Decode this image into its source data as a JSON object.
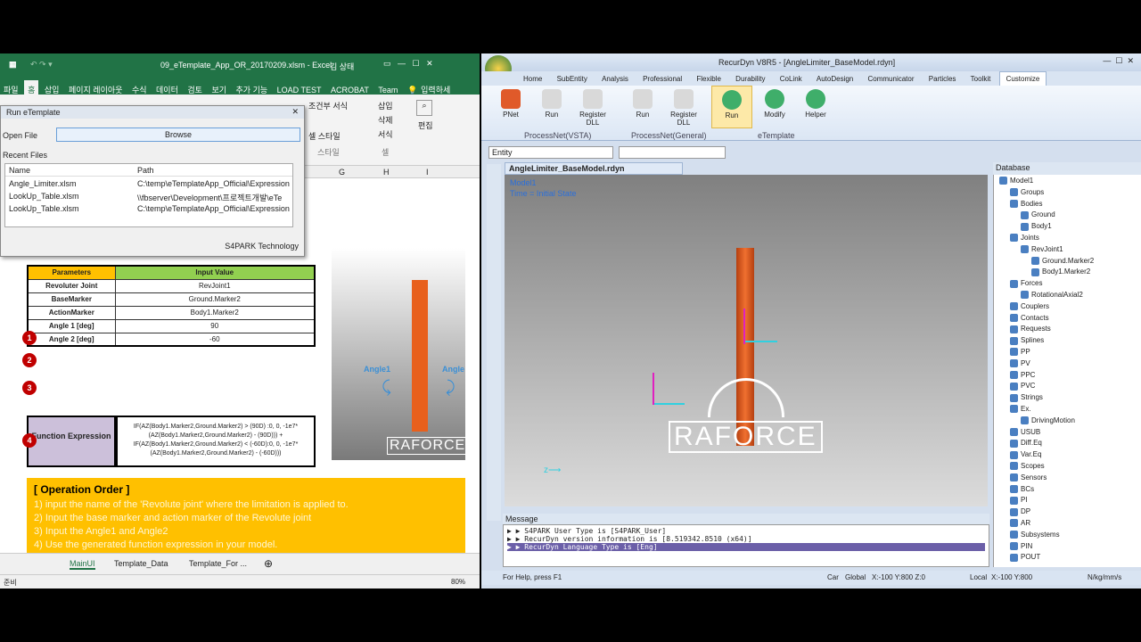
{
  "excel": {
    "title": "09_eTemplate_App_OR_20170209.xlsm  -  Excel",
    "user": "김 상태",
    "tabs": [
      "파일",
      "홈",
      "삽입",
      "페이지 레이아웃",
      "수식",
      "데이터",
      "검토",
      "보기",
      "추가 기능",
      "LOAD TEST",
      "ACROBAT",
      "Team"
    ],
    "tell_me": "입력하세",
    "ribbon": {
      "insert": "삽입",
      "delete": "삭제",
      "format": "서식",
      "cond": "조건부 서식",
      "style": "셀 스타일",
      "cells": "셀",
      "edit": "편집",
      "style_group": "스타일"
    },
    "dialog": {
      "title": "Run eTemplate",
      "open_file": "Open File",
      "browse": "Browse",
      "recent_files": "Recent Files",
      "col_name": "Name",
      "col_path": "Path",
      "rows": [
        {
          "name": "Angle_Limiter.xlsm",
          "path": "C:\\temp\\eTemplateApp_Official\\Expression"
        },
        {
          "name": "LookUp_Table.xlsm",
          "path": "\\\\fbserver\\Development\\프로젝트개발\\eTe"
        },
        {
          "name": "LookUp_Table.xlsm",
          "path": "C:\\temp\\eTemplateApp_Official\\Expression"
        }
      ],
      "footer": "S4PARK Technology"
    },
    "columns": [
      "G",
      "H",
      "I"
    ],
    "table": {
      "h_param": "Parameters",
      "h_input": "Input Value",
      "rows": [
        {
          "num": "1",
          "label": "Revoluter Joint",
          "value": "RevJoint1"
        },
        {
          "num": "2",
          "label": "BaseMarker",
          "value": "Ground.Marker2"
        },
        {
          "num": "",
          "label": "ActionMarker",
          "value": "Body1.Marker2"
        },
        {
          "num": "3",
          "label": "Angle 1 [deg]",
          "value": "90"
        },
        {
          "num": "",
          "label": "Angle 2 [deg]",
          "value": "-60"
        }
      ],
      "func_num": "4",
      "func_label": "Function Expression",
      "func_value": "IF(AZ(Body1.Marker2,Ground.Marker2) > (90D) :0, 0, -1e7*(AZ(Body1.Marker2,Ground.Marker2) - (90D))) + IF(AZ(Body1.Marker2,Ground.Marker2) < (-60D):0, 0, -1e7*(AZ(Body1.Marker2,Ground.Marker2) - (-60D)))"
    },
    "preview": {
      "angle1": "Angle1",
      "angle2": "Angle",
      "logo": "RAFORCE"
    },
    "op": {
      "title": "[ Operation Order ]",
      "steps": [
        "1) input the name of the 'Revolute joint' where the limitation is applied to.",
        "2) Input the base marker and action marker of the Revolute joint",
        "3) Input the Angle1 and Angle2",
        "4) Use the generated function expression in your model."
      ]
    },
    "sheets": [
      "MainUI",
      "Template_Data",
      "Template_For ..."
    ],
    "status": "준비",
    "zoom": "80%"
  },
  "recurdyn": {
    "title": "RecurDyn V8R5 - [AngleLimiter_BaseModel.rdyn]",
    "tabs": [
      "Home",
      "SubEntity",
      "Analysis",
      "Professional",
      "Flexible",
      "Durability",
      "CoLink",
      "AutoDesign",
      "Communicator",
      "Particles",
      "Toolkit",
      "Customize"
    ],
    "ribbon_buttons": [
      {
        "label": "PNet",
        "group": "ProcessNet(VSTA)"
      },
      {
        "label": "Run",
        "group": "ProcessNet(VSTA)"
      },
      {
        "label": "Register DLL",
        "group": "ProcessNet(VSTA)"
      },
      {
        "label": "Run",
        "group": "ProcessNet(General)"
      },
      {
        "label": "Register DLL",
        "group": "ProcessNet(General)"
      },
      {
        "label": "Run",
        "group": "eTemplate"
      },
      {
        "label": "Modify",
        "group": "eTemplate"
      },
      {
        "label": "Helper",
        "group": "eTemplate"
      }
    ],
    "groups": [
      "ProcessNet(VSTA)",
      "ProcessNet(General)",
      "eTemplate"
    ],
    "entity": "Entity",
    "doc_tab": "AngleLimiter_BaseModel.rdyn",
    "vp_model": "Model1",
    "vp_time": "Time  =  Initial State",
    "logo": "RAFORCE",
    "database_title": "Database",
    "tree": [
      {
        "t": "Model1",
        "d": 0
      },
      {
        "t": "Groups",
        "d": 1
      },
      {
        "t": "Bodies",
        "d": 1
      },
      {
        "t": "Ground",
        "d": 2
      },
      {
        "t": "Body1",
        "d": 2
      },
      {
        "t": "Joints",
        "d": 1
      },
      {
        "t": "RevJoint1",
        "d": 2
      },
      {
        "t": "Ground.Marker2",
        "d": 3
      },
      {
        "t": "Body1.Marker2",
        "d": 3
      },
      {
        "t": "Forces",
        "d": 1
      },
      {
        "t": "RotationalAxial2",
        "d": 2
      },
      {
        "t": "Couplers",
        "d": 1
      },
      {
        "t": "Contacts",
        "d": 1
      },
      {
        "t": "Requests",
        "d": 1
      },
      {
        "t": "Splines",
        "d": 1
      },
      {
        "t": "PP",
        "d": 1
      },
      {
        "t": "PV",
        "d": 1
      },
      {
        "t": "PPC",
        "d": 1
      },
      {
        "t": "PVC",
        "d": 1
      },
      {
        "t": "Strings",
        "d": 1
      },
      {
        "t": "Ex.",
        "d": 1
      },
      {
        "t": "DrivingMotion",
        "d": 2
      },
      {
        "t": "USUB",
        "d": 1
      },
      {
        "t": "Diff.Eq",
        "d": 1
      },
      {
        "t": "Var.Eq",
        "d": 1
      },
      {
        "t": "Scopes",
        "d": 1
      },
      {
        "t": "Sensors",
        "d": 1
      },
      {
        "t": "BCs",
        "d": 1
      },
      {
        "t": "PI",
        "d": 1
      },
      {
        "t": "DP",
        "d": 1
      },
      {
        "t": "AR",
        "d": 1
      },
      {
        "t": "Subsystems",
        "d": 1
      },
      {
        "t": "PIN",
        "d": 1
      },
      {
        "t": "POUT",
        "d": 1
      }
    ],
    "message_title": "Message",
    "messages": [
      "▶ ▶ S4PARK User Type  is [S4PARK_User]",
      "▶ ▶ RecurDyn version information is [8.519342.8510 (x64)]",
      "▶ ▶ RecurDyn Language Type  is [Eng]"
    ],
    "status": {
      "help": "For Help, press F1",
      "car": "Car",
      "global": "Global",
      "coords": "X:-100 Y:800 Z:0",
      "local": "Local",
      "local_coords": "X:-100 Y:800",
      "units": "N/kg/mm/s"
    }
  },
  "colors": {
    "excel_green": "#217346",
    "param_header": "#ffc000",
    "input_header": "#92d050",
    "func_bg": "#ccc0da",
    "op_bg": "#ffc000",
    "marker_red": "#c00000",
    "rod": "#e8601c"
  }
}
